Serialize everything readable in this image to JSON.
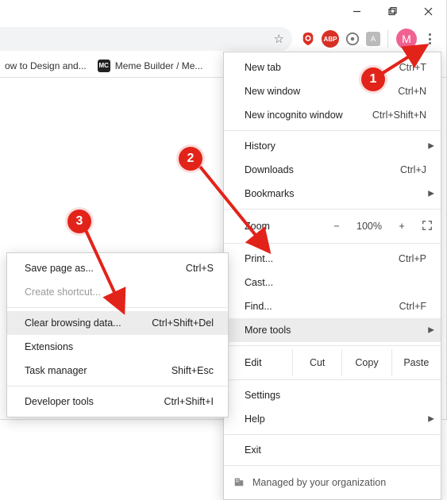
{
  "window_controls": {
    "minimize": "minimize",
    "maximize": "maximize",
    "close": "close"
  },
  "toolbar": {
    "profile_letter": "M",
    "extensions": {
      "adblock_plus_label": "ABP",
      "awesome_label": "A"
    }
  },
  "bookmarks": [
    {
      "title": "ow to Design and..."
    },
    {
      "favicon": "MC",
      "title": "Meme Builder / Me..."
    }
  ],
  "menu": {
    "new_tab": {
      "label": "New tab",
      "shortcut": "Ctrl+T"
    },
    "new_window": {
      "label": "New window",
      "shortcut": "Ctrl+N"
    },
    "new_incognito": {
      "label": "New incognito window",
      "shortcut": "Ctrl+Shift+N"
    },
    "history": {
      "label": "History"
    },
    "downloads": {
      "label": "Downloads",
      "shortcut": "Ctrl+J"
    },
    "bookmarks": {
      "label": "Bookmarks"
    },
    "zoom": {
      "label": "Zoom",
      "value": "100%",
      "minus": "−",
      "plus": "+"
    },
    "print": {
      "label": "Print...",
      "shortcut": "Ctrl+P"
    },
    "cast": {
      "label": "Cast..."
    },
    "find": {
      "label": "Find...",
      "shortcut": "Ctrl+F"
    },
    "more_tools": {
      "label": "More tools"
    },
    "edit": {
      "label": "Edit",
      "cut": "Cut",
      "copy": "Copy",
      "paste": "Paste"
    },
    "settings": {
      "label": "Settings"
    },
    "help": {
      "label": "Help"
    },
    "exit": {
      "label": "Exit"
    },
    "managed": {
      "label": "Managed by your organization"
    }
  },
  "submenu": {
    "save_page": {
      "label": "Save page as...",
      "shortcut": "Ctrl+S"
    },
    "create_shortcut": {
      "label": "Create shortcut..."
    },
    "clear_browsing": {
      "label": "Clear browsing data...",
      "shortcut": "Ctrl+Shift+Del"
    },
    "extensions": {
      "label": "Extensions"
    },
    "task_manager": {
      "label": "Task manager",
      "shortcut": "Shift+Esc"
    },
    "dev_tools": {
      "label": "Developer tools",
      "shortcut": "Ctrl+Shift+I"
    }
  },
  "steps": {
    "one": "1",
    "two": "2",
    "three": "3"
  }
}
